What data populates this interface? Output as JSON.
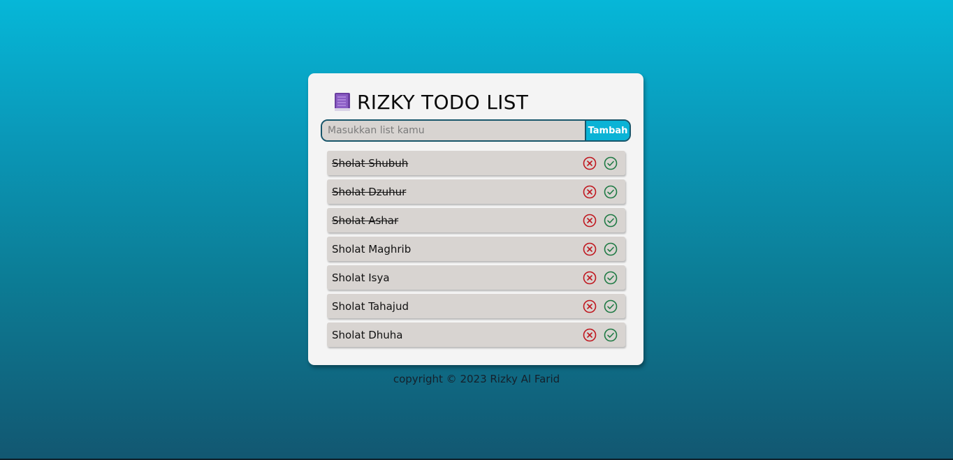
{
  "app": {
    "title": "RIZKY TODO LIST",
    "title_icon": "book-icon"
  },
  "form": {
    "placeholder": "Masukkan list kamu",
    "value": "",
    "add_label": "Tambah"
  },
  "todos": [
    {
      "text": "Sholat Shubuh",
      "done": true
    },
    {
      "text": "Sholat Dzuhur",
      "done": true
    },
    {
      "text": "Sholat Ashar",
      "done": true
    },
    {
      "text": "Sholat Maghrib",
      "done": false
    },
    {
      "text": "Sholat Isya",
      "done": false
    },
    {
      "text": "Sholat Tahajud",
      "done": false
    },
    {
      "text": "Sholat Dhuha",
      "done": false
    }
  ],
  "item_actions": {
    "delete_icon": "circle-x-icon",
    "complete_icon": "circle-check-icon"
  },
  "colors": {
    "accent": "#0ab3d6",
    "delete": "#c0171f",
    "complete": "#1f7a44",
    "border": "#18566b"
  },
  "footer": {
    "text": "copyright © 2023 Rizky Al Farid"
  }
}
